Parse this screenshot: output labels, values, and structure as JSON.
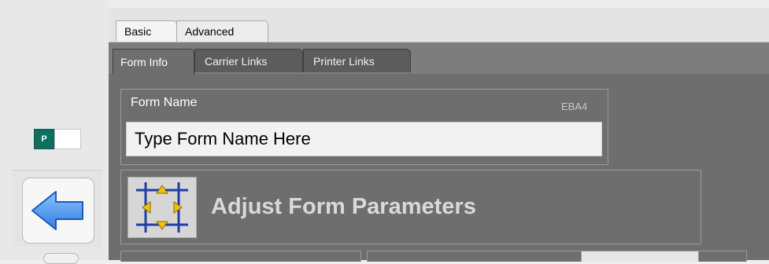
{
  "tabs_top": [
    {
      "label": "Basic",
      "active": true
    },
    {
      "label": "Advanced",
      "active": false
    }
  ],
  "sub_tabs": [
    {
      "label": "Form Info",
      "active": true
    },
    {
      "label": "Carrier Links",
      "active": false
    },
    {
      "label": "Printer Links",
      "active": false
    }
  ],
  "form_name": {
    "label": "Form Name",
    "code": "EBA4",
    "placeholder": "Type Form Name Here"
  },
  "adjust": {
    "label": "Adjust Form Parameters",
    "icon": "adjust-parameters-icon"
  },
  "badge": {
    "label": "P",
    "color": "#0f6f5e"
  },
  "colors": {
    "panel": "#6e6e6e",
    "accent_arrow": "#2f7fe0"
  }
}
